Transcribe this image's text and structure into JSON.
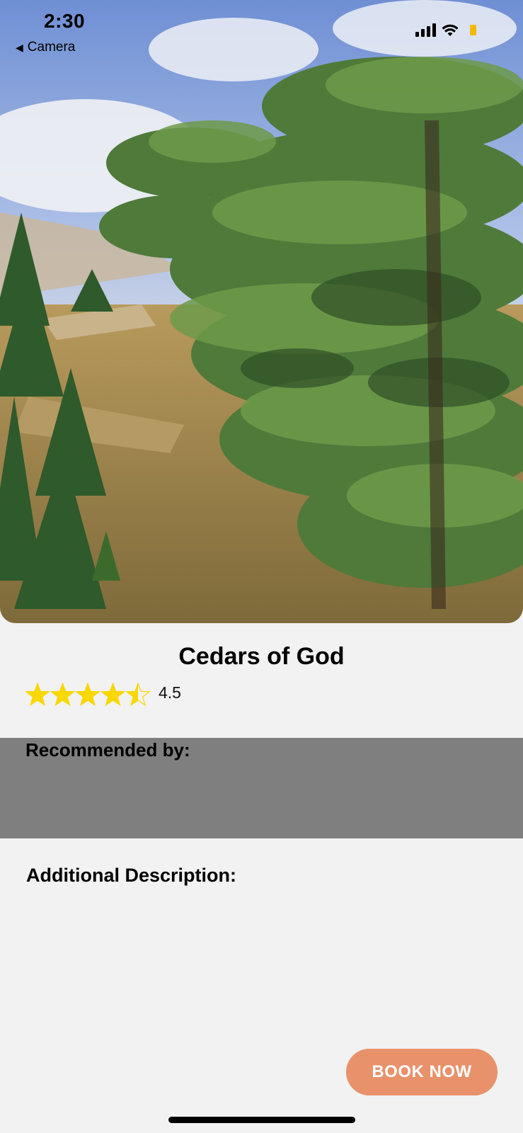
{
  "status_bar": {
    "time": "2:30",
    "back_label": "Camera",
    "battery_color": "#f5b800"
  },
  "hero": {
    "image": "cedar-forest-photo"
  },
  "place": {
    "name": "Cedars of God",
    "rating": 4.5,
    "rating_text": "4.5",
    "rating_max": 5,
    "star_color": "#f9d700"
  },
  "sections": {
    "recommended_label": "Recommended by:",
    "recommended_band_color": "#7f7f7f",
    "description_label": "Additional Description:"
  },
  "actions": {
    "book_label": "BOOK NOW",
    "book_color": "#e8916a"
  }
}
